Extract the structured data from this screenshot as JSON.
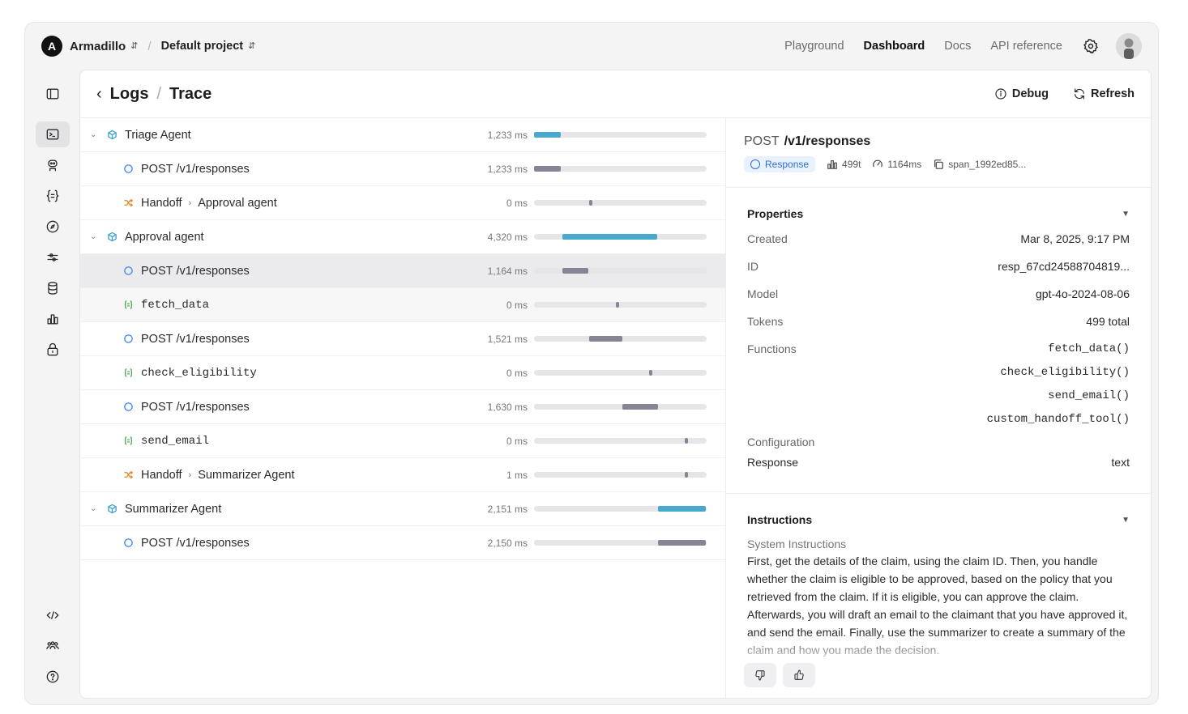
{
  "topbar": {
    "org_initial": "A",
    "org_name": "Armadillo",
    "separator": "/",
    "project": "Default project",
    "nav": [
      "Playground",
      "Dashboard",
      "Docs",
      "API reference"
    ],
    "active_nav": "Dashboard"
  },
  "rail": {
    "icons": [
      "sidebar-toggle-icon",
      "terminal-logs-icon",
      "assistant-bot-icon",
      "functions-braces-icon",
      "compass-explore-icon",
      "sliders-tune-icon",
      "database-storage-icon",
      "bar-chart-usage-icon",
      "lock-security-icon",
      "code-icon",
      "team-users-icon",
      "help-icon"
    ],
    "active": "terminal-logs-icon"
  },
  "header": {
    "back": "<",
    "crumb_1": "Logs",
    "crumb_sep": "/",
    "crumb_2": "Trace",
    "debug": "Debug",
    "refresh": "Refresh"
  },
  "trace": {
    "total_ms": 9625,
    "rows": [
      {
        "kind": "agent",
        "label": "Triage Agent",
        "dur": "1,233 ms",
        "start": 0.0,
        "len": 0.157,
        "color": "blue"
      },
      {
        "kind": "response",
        "method": "POST",
        "path": "/v1/responses",
        "dur": "1,233 ms",
        "start": 0.0,
        "len": 0.157,
        "color": "gray"
      },
      {
        "kind": "handoff",
        "label": "Handoff",
        "target": "Approval agent",
        "dur": "0 ms",
        "start": 0.165,
        "len": 0.018,
        "color": "gray"
      },
      {
        "kind": "agent",
        "label": "Approval agent",
        "dur": "4,320 ms",
        "start": 0.165,
        "len": 0.55,
        "color": "blue"
      },
      {
        "kind": "response",
        "method": "POST",
        "path": "/v1/responses",
        "dur": "1,164 ms",
        "start": 0.165,
        "len": 0.148,
        "color": "gray",
        "selected": true
      },
      {
        "kind": "function",
        "label": "fetch_data",
        "dur": "0 ms",
        "start": 0.318,
        "len": 0.018,
        "color": "gray"
      },
      {
        "kind": "response",
        "method": "POST",
        "path": "/v1/responses",
        "dur": "1,521 ms",
        "start": 0.318,
        "len": 0.194,
        "color": "gray"
      },
      {
        "kind": "function",
        "label": "check_eligibility",
        "dur": "0 ms",
        "start": 0.51,
        "len": 0.018,
        "color": "gray"
      },
      {
        "kind": "response",
        "method": "POST",
        "path": "/v1/responses",
        "dur": "1,630 ms",
        "start": 0.51,
        "len": 0.207,
        "color": "gray"
      },
      {
        "kind": "function",
        "label": "send_email",
        "dur": "0 ms",
        "start": 0.72,
        "len": 0.018,
        "color": "gray"
      },
      {
        "kind": "handoff",
        "label": "Handoff",
        "target": "Summarizer Agent",
        "dur": "1 ms",
        "start": 0.72,
        "len": 0.018,
        "color": "gray"
      },
      {
        "kind": "agent",
        "label": "Summarizer Agent",
        "dur": "2,151 ms",
        "start": 0.72,
        "len": 0.275,
        "color": "blue"
      },
      {
        "kind": "response",
        "method": "POST",
        "path": "/v1/responses",
        "dur": "2,150 ms",
        "start": 0.72,
        "len": 0.275,
        "color": "gray"
      }
    ]
  },
  "detail": {
    "method": "POST",
    "path": "/v1/responses",
    "badge": "Response",
    "tokens": "499t",
    "latency": "1164ms",
    "span": "span_1992ed85...",
    "properties_title": "Properties",
    "props": [
      {
        "k": "Created",
        "v": "Mar 8, 2025, 9:17 PM"
      },
      {
        "k": "ID",
        "v": "resp_67cd24588704819..."
      },
      {
        "k": "Model",
        "v": "gpt-4o-2024-08-06"
      },
      {
        "k": "Tokens",
        "v": "499 total"
      }
    ],
    "functions_label": "Functions",
    "functions": [
      "fetch_data()",
      "check_eligibility()",
      "send_email()",
      "custom_handoff_tool()"
    ],
    "configuration_label": "Configuration",
    "response_label": "Response",
    "response_value": "text",
    "instructions_title": "Instructions",
    "system_instructions_label": "System Instructions",
    "system_instructions": "First, get the details of the claim, using the claim ID. Then, you handle whether the claim is eligible to be approved, based on the policy that you retrieved from the claim. If it is eligible, you can approve the claim. Afterwards, you will draft an email to the claimant that you have approved it, and send the email. Finally, use the summarizer to create a summary of the claim and how you made the decision."
  },
  "colors": {
    "accent_blue": "#4aa8cc",
    "badge_blue": "#2f6fd3",
    "function_green": "#2f9e44",
    "handoff_orange": "#e08a2c"
  }
}
